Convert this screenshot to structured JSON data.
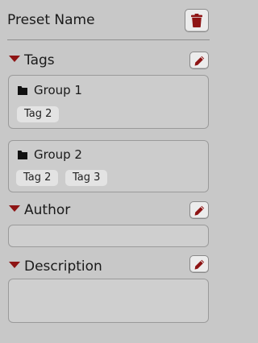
{
  "header": {
    "title": "Preset Name"
  },
  "sections": {
    "tags": {
      "label": "Tags",
      "groups": [
        {
          "name": "Group 1",
          "tags": [
            "Tag 2"
          ]
        },
        {
          "name": "Group 2",
          "tags": [
            "Tag 2",
            "Tag 3"
          ]
        }
      ]
    },
    "author": {
      "label": "Author",
      "value": ""
    },
    "description": {
      "label": "Description",
      "value": ""
    }
  },
  "colors": {
    "accent": "#8e1414",
    "background": "#c8c8c8",
    "chip": "#e3e3e3"
  },
  "icons": {
    "delete": "trash-icon",
    "edit": "pencil-icon",
    "collapse": "caret-down-icon",
    "group": "folder-icon"
  }
}
